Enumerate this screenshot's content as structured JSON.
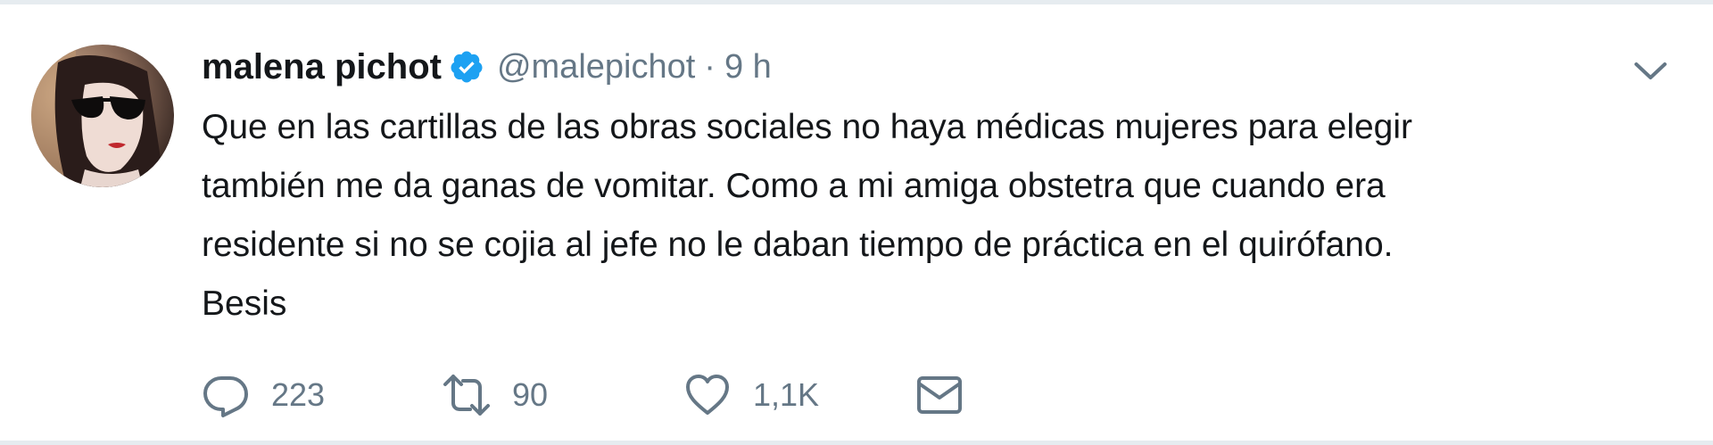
{
  "tweet": {
    "author_name": "malena pichot",
    "handle": "@malepichot",
    "separator": "·",
    "time": "9 h",
    "verified": true,
    "text_lines": [
      "Que en las cartillas de las obras sociales no haya médicas mujeres para elegir",
      "también me da ganas de vomitar. Como a mi amiga obstetra que cuando era",
      "residente si no se cojia al jefe no le daban tiempo de práctica en el quirófano.",
      "Besis"
    ]
  },
  "actions": {
    "reply": {
      "icon": "reply-icon",
      "count": "223"
    },
    "retweet": {
      "icon": "retweet-icon",
      "count": "90"
    },
    "like": {
      "icon": "heart-icon",
      "count": "1,1K"
    },
    "message": {
      "icon": "envelope-icon"
    }
  },
  "colors": {
    "primary_text": "#14171a",
    "secondary_text": "#657786",
    "verified_blue": "#1da1f2",
    "divider": "#e6ecf0"
  }
}
